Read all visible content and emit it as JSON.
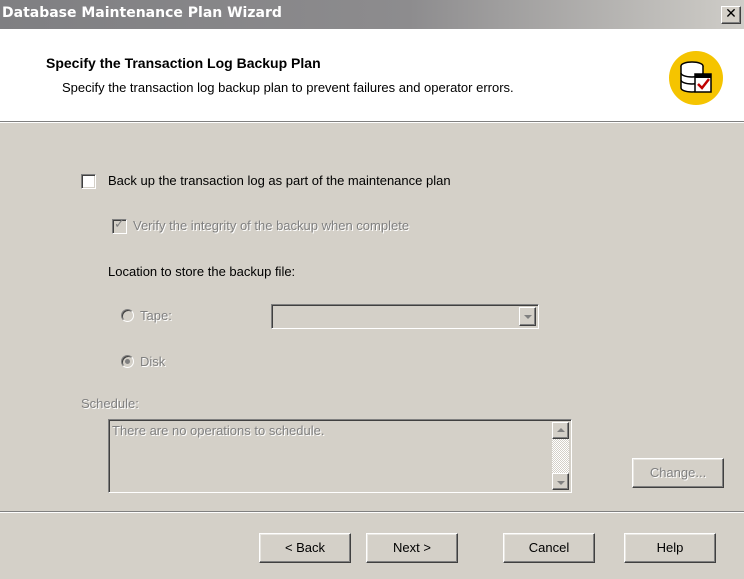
{
  "window": {
    "title": "Database Maintenance Plan Wizard",
    "close_label": "✕"
  },
  "header": {
    "title": "Specify the Transaction Log Backup Plan",
    "subtitle": "Specify the transaction log backup plan to prevent failures and operator errors.",
    "icon": "database-check-icon"
  },
  "options": {
    "backup_log": {
      "label": "Back up the transaction log as part of the maintenance plan",
      "checked": false
    },
    "verify": {
      "label": "Verify the integrity of the backup when complete",
      "checked": true,
      "enabled": false
    },
    "location_label": "Location to store the backup file:",
    "tape": {
      "label": "Tape:",
      "selected": false,
      "value": ""
    },
    "disk": {
      "label": "Disk",
      "selected": true
    }
  },
  "schedule": {
    "label": "Schedule:",
    "text": "There are no operations to schedule.",
    "change_label": "Change..."
  },
  "buttons": {
    "back": "< Back",
    "next": "Next >",
    "cancel": "Cancel",
    "help": "Help"
  },
  "colors": {
    "dialog_bg": "#d4d0c8",
    "header_bg": "#ffffff",
    "icon_accent": "#f5c400",
    "disabled_text": "#808080"
  }
}
